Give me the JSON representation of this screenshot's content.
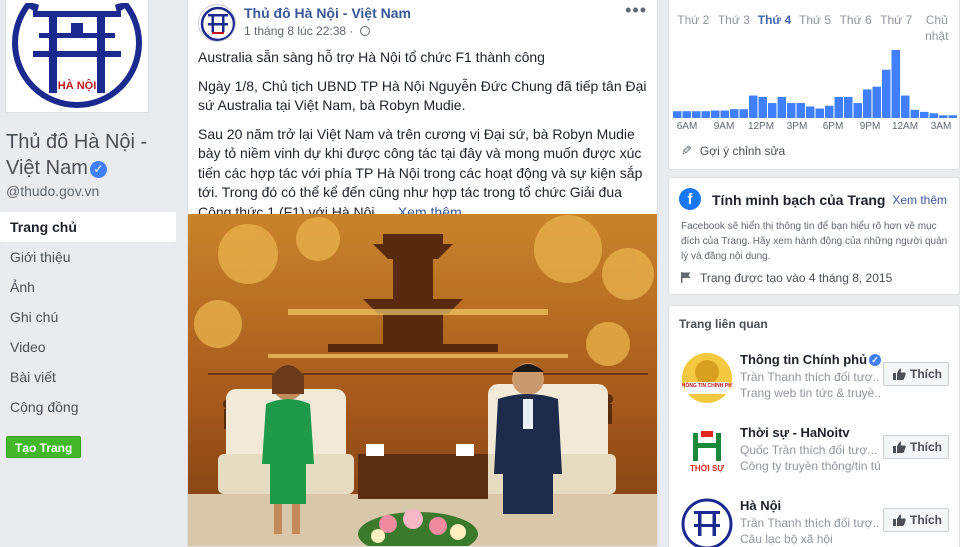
{
  "page": {
    "name": "Thủ đô Hà Nội - Việt Nam",
    "handle": "@thudo.gov.vn",
    "logo_text": "HÀ NỘI",
    "verified_icon": "✓"
  },
  "nav": {
    "items": [
      {
        "label": "Trang chủ",
        "active": true
      },
      {
        "label": "Giới thiệu"
      },
      {
        "label": "Ảnh"
      },
      {
        "label": "Ghi chú"
      },
      {
        "label": "Video"
      },
      {
        "label": "Bài viết"
      },
      {
        "label": "Cộng đồng"
      }
    ],
    "create_page": "Tạo Trang"
  },
  "post": {
    "author": "Thủ đô Hà Nội - Việt Nam",
    "time": "1 tháng 8 lúc 22:38",
    "more": "•••",
    "title_line": "Australia sẵn sàng hỗ trợ Hà Nội tổ chức F1 thành công",
    "para1": "Ngày 1/8, Chủ tịch UBND TP Hà Nội Nguyễn Đức Chung đã tiếp tân Đại sứ Australia tại Việt Nam, bà Robyn Mudie.",
    "para2": "Sau 20 năm trở lại Việt Nam và trên cương vị Đại sứ, bà Robyn Mudie bày tỏ niềm vinh dự khi được công tác tại đây và mong muốn được xúc tiến các hợp tác với phía TP Hà Nội trong các hoạt động và sự kiện sắp tới. Trong đó có thể kể đến cũng như hợp tác trong tổ chức Giải đua Công thức 1 (F1) với Hà Nội.",
    "see_more": "... Xem thêm"
  },
  "hours": {
    "days": [
      "Thứ 2",
      "Thứ 3",
      "Thứ 4",
      "Thứ 5",
      "Thứ 6",
      "Thứ 7",
      "Chủ nhật"
    ],
    "active_day": "Thứ 4",
    "hour_labels": [
      "6AM",
      "9AM",
      "12PM",
      "3PM",
      "6PM",
      "9PM",
      "12AM",
      "3AM"
    ],
    "bar_values": [
      0.1,
      0.1,
      0.1,
      0.1,
      0.11,
      0.11,
      0.13,
      0.13,
      0.33,
      0.31,
      0.22,
      0.31,
      0.22,
      0.22,
      0.17,
      0.14,
      0.18,
      0.31,
      0.31,
      0.22,
      0.42,
      0.46,
      0.71,
      1.0,
      0.33,
      0.12,
      0.09,
      0.07,
      0.04,
      0.04
    ],
    "bar_color": "#4080ff",
    "suggest_edit": "Gợi ý chỉnh sửa"
  },
  "transparency": {
    "title": "Tính minh bạch của Trang",
    "see_more": "Xem thêm",
    "description": "Facebook sẽ hiển thị thông tin để bạn hiểu rõ hơn về mục đích của Trang. Hãy xem hành động của những người quản lý và đăng nội dung.",
    "created": "Trang được tạo vào 4 tháng 8, 2015"
  },
  "related": {
    "title": "Trang liên quan",
    "like_label": "Thích",
    "pages": [
      {
        "name": "Thông tin Chính phủ",
        "verified": true,
        "friend": "Trần Thanh",
        "action": " thích đối tượ...",
        "category": "Trang web tin tức & truyề...",
        "logo_text": "THÔNG TIN CHÍNH PHỦ"
      },
      {
        "name": "Thời sự - HaNoitv",
        "verified": false,
        "friend": "Quốc Trần",
        "action": " thích đối tượ...",
        "category": "Công ty truyền thông/tin tức",
        "logo_text": "THỜI SỰ"
      },
      {
        "name": "Hà Nội",
        "verified": false,
        "friend": "Trần Thanh",
        "action": " thích đối tượ...",
        "category": "Câu lạc bộ xã hội",
        "logo_text": ""
      }
    ]
  },
  "colors": {
    "link": "#385898",
    "brand_blue": "#4267b2",
    "logo_navy": "#1b2a8f",
    "green": "#42b72a"
  }
}
